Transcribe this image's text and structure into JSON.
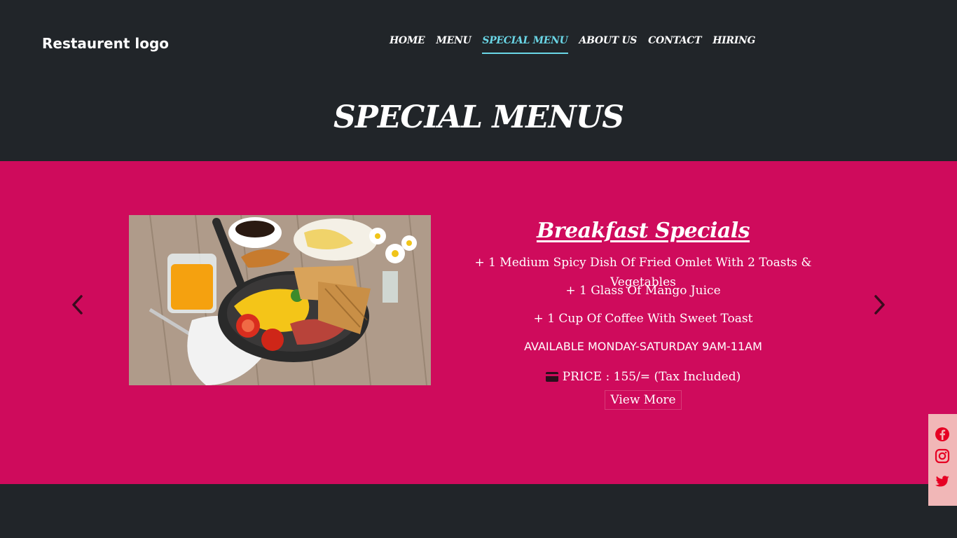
{
  "header": {
    "logo": "Restaurent logo",
    "nav": [
      {
        "label": "HOME"
      },
      {
        "label": "MENU"
      },
      {
        "label": "SPECIAL MENU"
      },
      {
        "label": "ABOUT US"
      },
      {
        "label": "CONTACT"
      },
      {
        "label": "HIRING"
      }
    ],
    "active_nav": "SPECIAL MENU",
    "page_title": "SPECIAL MENUS"
  },
  "carousel": {
    "prev_icon": "chevron-left-icon",
    "next_icon": "chevron-right-icon",
    "image": "breakfast-photo",
    "title": "Breakfast Specials",
    "items": [
      "+ 1 Medium Spicy Dish Of Fried Omlet With 2 Toasts & Vegetables",
      "+ 1 Glass Of Mango Juice",
      "+ 1 Cup Of Coffee With Sweet Toast"
    ],
    "availability": "AVAILABLE MONDAY-SATURDAY 9AM-11AM",
    "price_icon": "credit-card-icon",
    "price": "PRICE : 155/= (Tax Included)",
    "view_more": "View More"
  },
  "social": [
    "facebook-icon",
    "instagram-icon",
    "twitter-icon"
  ],
  "colors": {
    "background": "#212529",
    "accent": "#cf0b5c",
    "nav_active": "#6ad6e6",
    "social_bg": "#f1b7b7",
    "social_icon": "#e60023"
  }
}
